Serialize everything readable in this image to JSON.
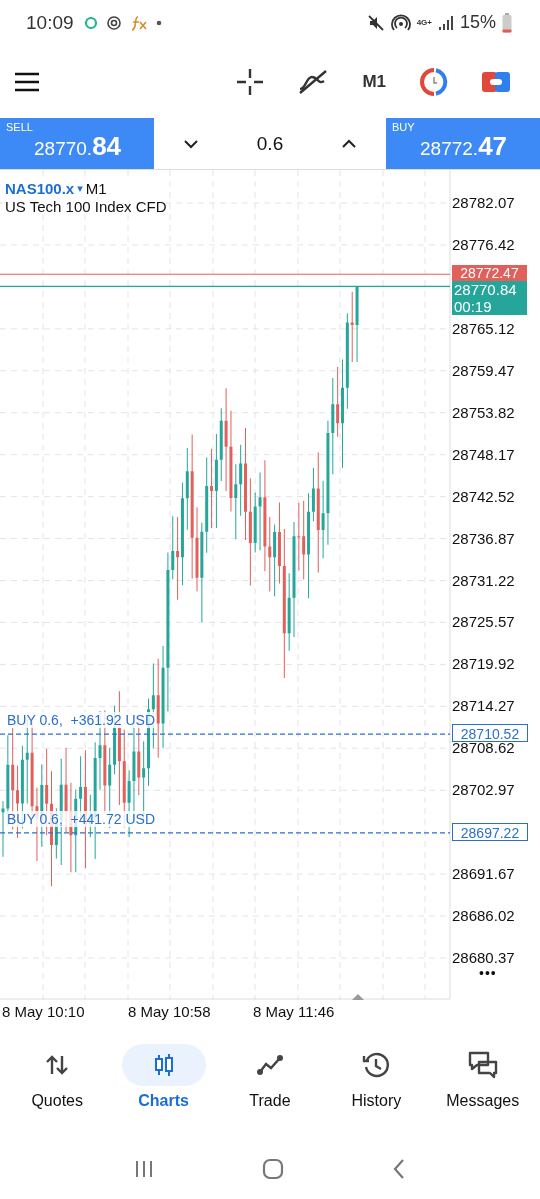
{
  "status_bar": {
    "time": "10:09",
    "network": "4G+",
    "battery": "15%"
  },
  "toolbar": {
    "timeframe": "M1"
  },
  "quote_bar": {
    "sell": {
      "label": "SELL",
      "price_main": "28770.",
      "price_big": "84"
    },
    "volume": "0.6",
    "buy": {
      "label": "BUY",
      "price_main": "28772.",
      "price_big": "47"
    }
  },
  "chart": {
    "symbol": "NAS100.x",
    "dropdown": "▾",
    "timeframe": "M1",
    "description": "US Tech 100 Index CFD",
    "y_ticks": [
      "28782.07",
      "28776.42",
      "28765.12",
      "28759.47",
      "28753.82",
      "28748.17",
      "28742.52",
      "28736.87",
      "28731.22",
      "28725.57",
      "28719.92",
      "28714.27",
      "28708.62",
      "28702.97",
      "28691.67",
      "28686.02",
      "28680.37"
    ],
    "ask_price": "28772.47",
    "bid_price": "28770.84",
    "countdown": "00:19",
    "orders": [
      {
        "label": "BUY 0.6,  +361.92 USD",
        "price": "28710.52"
      },
      {
        "label": "BUY 0.6,  +441.72 USD",
        "price": "28697.22"
      }
    ],
    "more": "•••",
    "x_labels": [
      "8 May 10:10",
      "8 May 10:58",
      "8 May 11:46"
    ]
  },
  "nav": [
    {
      "kind": "quotes",
      "label": "Quotes",
      "selected": false
    },
    {
      "kind": "charts",
      "label": "Charts",
      "selected": true
    },
    {
      "kind": "trade",
      "label": "Trade",
      "selected": false
    },
    {
      "kind": "history",
      "label": "History",
      "selected": false
    },
    {
      "kind": "messages",
      "label": "Messages",
      "selected": false
    }
  ]
}
